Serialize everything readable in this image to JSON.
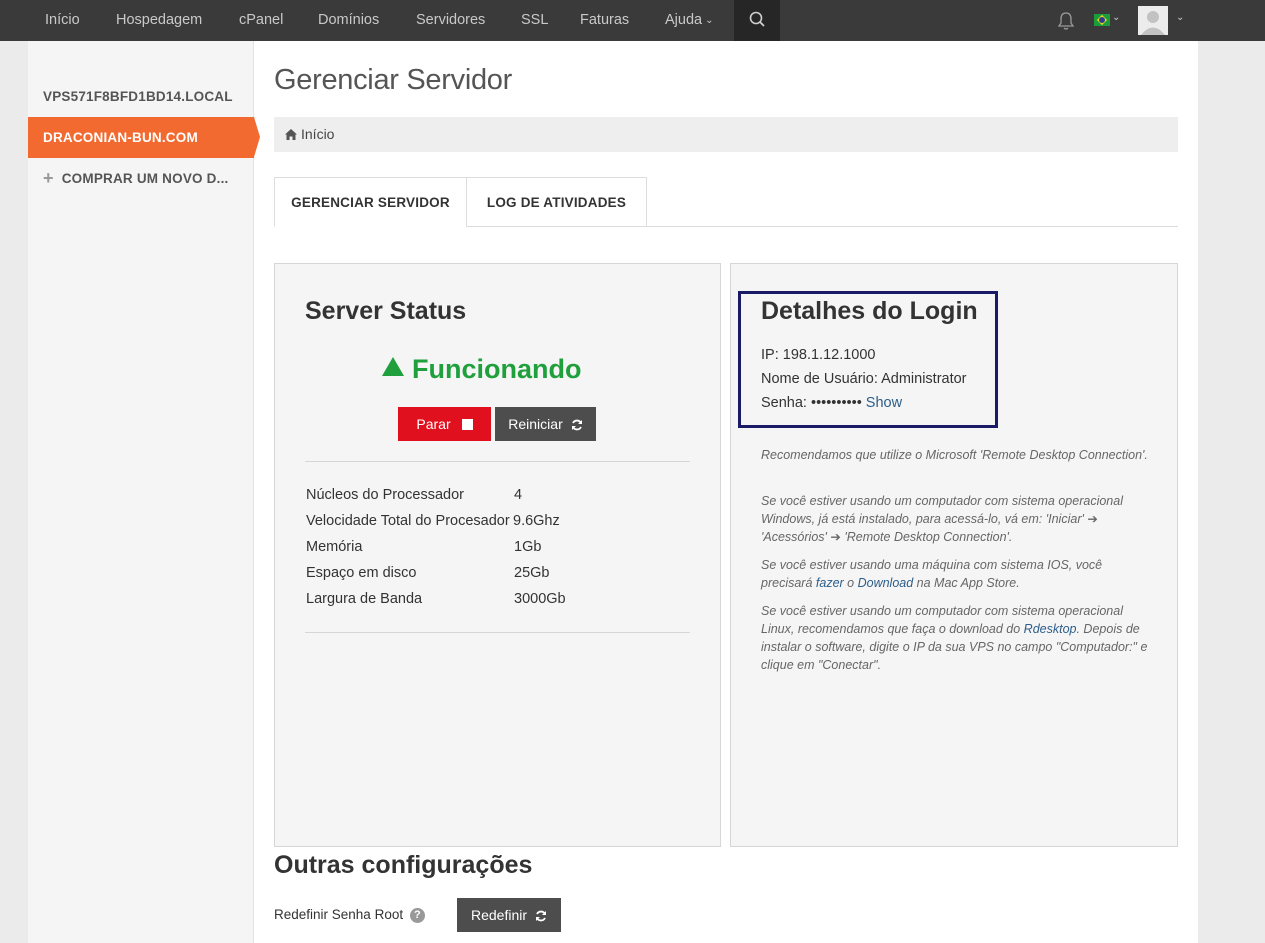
{
  "topnav": {
    "items": [
      "Início",
      "Hospedagem",
      "cPanel",
      "Domínios",
      "Servidores",
      "SSL",
      "Faturas",
      "Ajuda"
    ]
  },
  "sidebar": {
    "items": [
      {
        "label": "VPS571F8BFD1BD14.LOCAL"
      },
      {
        "label": "DRACONIAN-BUN.COM"
      },
      {
        "label": "COMPRAR UM NOVO D..."
      }
    ]
  },
  "page": {
    "title": "Gerenciar Servidor",
    "breadcrumb": "Início"
  },
  "tabs": [
    "GERENCIAR SERVIDOR",
    "LOG DE ATIVIDADES"
  ],
  "server_status": {
    "heading": "Server Status",
    "status": "Funcionando",
    "stop_label": "Parar",
    "reboot_label": "Reiniciar",
    "specs": [
      {
        "label": "Núcleos do Processador",
        "value": "4"
      },
      {
        "label": "Velocidade Total do Procesador",
        "value": "9.6Ghz"
      },
      {
        "label": "Memória",
        "value": "1Gb"
      },
      {
        "label": "Espaço em disco",
        "value": "25Gb"
      },
      {
        "label": "Largura de Banda",
        "value": "3000Gb"
      }
    ]
  },
  "login": {
    "heading": "Detalhes do Login",
    "ip_label": "IP:",
    "ip": "198.1.12.1000",
    "user_label": "Nome de Usuário:",
    "user": "Administrator",
    "password_label": "Senha:",
    "password_mask": "••••••••••",
    "show_label": "Show"
  },
  "info": {
    "p1": "Recomendamos que utilize o Microsoft 'Remote Desktop Connection'.",
    "p2": "Se você estiver usando um computador com sistema operacional Windows, já está instalado, para acessá-lo, vá em: 'Iniciar' ➔ 'Acessórios' ➔ 'Remote Desktop Connection'.",
    "p3_pre": "Se você estiver usando uma máquina com sistema IOS, você precisará ",
    "p3_link1": "fazer",
    "p3_mid": " o ",
    "p3_link2": "Download",
    "p3_post": " na Mac App Store.",
    "p4_pre": "Se você estiver usando um computador com sistema operacional Linux, recomendamos que faça o download do ",
    "p4_link": "Rdesktop",
    "p4_post": ". Depois de instalar o software, digite o IP da sua VPS no campo \"Computador:\" e clique em \"Conectar\"."
  },
  "outras": {
    "heading": "Outras configurações",
    "root_label": "Redefinir Senha Root",
    "help": "?",
    "redefinir_label": "Redefinir"
  }
}
